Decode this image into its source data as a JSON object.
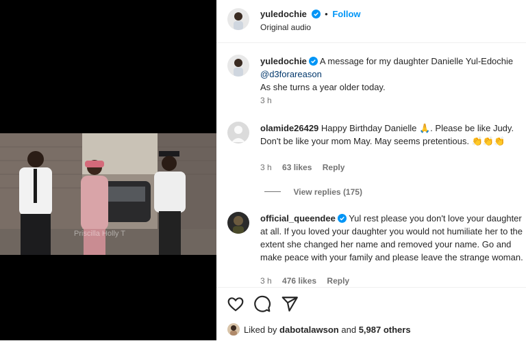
{
  "header": {
    "username": "yuledochie",
    "separator": "•",
    "follow_label": "Follow",
    "audio_label": "Original audio"
  },
  "caption": {
    "username": "yuledochie",
    "text_line1": "A message for my daughter Danielle Yul-Edochie",
    "mention": "@d3forareason",
    "text_line2": "As she turns a year older today.",
    "time": "3 h"
  },
  "comments": [
    {
      "username": "olamide26429",
      "text": "Happy Birthday Danielle 🙏. Please be like Judy. Don't be like your mom May. May seems pretentious. 👏👏👏",
      "time": "3 h",
      "likes": "63 likes",
      "reply_label": "Reply",
      "view_replies": "View replies (175)"
    },
    {
      "username": "official_queendee",
      "text": "Yul rest please you don't love your daughter at all. If you loved your daughter you would not humiliate her to the extent she changed her name and removed your name. Go and make peace with your family and please leave the strange woman.",
      "time": "3 h",
      "likes": "476 likes",
      "reply_label": "Reply"
    }
  ],
  "watermark": "Priscilla Holly T",
  "likes_row": {
    "prefix": "Liked by",
    "user": "dabotalawson",
    "middle": "and",
    "count": "5,987 others"
  },
  "icons": {
    "like": "heart-icon",
    "comment": "comment-icon",
    "share": "share-icon",
    "verified": "verified-badge-icon"
  },
  "colors": {
    "follow_blue": "#0095f6",
    "verified_blue": "#0095f6",
    "muted": "#737373"
  }
}
